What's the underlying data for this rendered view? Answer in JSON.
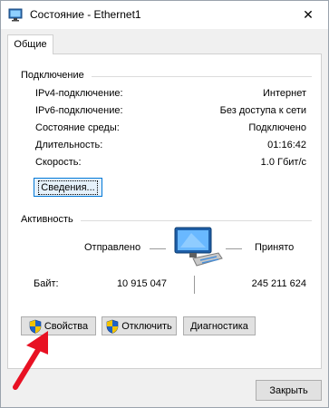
{
  "window": {
    "title": "Состояние - Ethernet1",
    "close_glyph": "✕"
  },
  "tabs": [
    {
      "label": "Общие"
    }
  ],
  "connection": {
    "header": "Подключение",
    "rows": [
      {
        "label": "IPv4-подключение:",
        "value": "Интернет"
      },
      {
        "label": "IPv6-подключение:",
        "value": "Без доступа к сети"
      },
      {
        "label": "Состояние среды:",
        "value": "Подключено"
      },
      {
        "label": "Длительность:",
        "value": "01:16:42"
      },
      {
        "label": "Скорость:",
        "value": "1.0 Гбит/с"
      }
    ],
    "details_button": "Сведения..."
  },
  "activity": {
    "header": "Активность",
    "sent_label": "Отправлено",
    "received_label": "Принято",
    "bytes_label": "Байт:",
    "bytes_sent": "10 915 047",
    "bytes_received": "245 211 624"
  },
  "actions": {
    "properties": "Свойства",
    "disable": "Отключить",
    "diagnose": "Диагностика"
  },
  "footer": {
    "close_button": "Закрыть"
  },
  "colors": {
    "accent": "#0078d7",
    "annotation_arrow": "#e81123"
  },
  "icons": [
    "network-adapter-icon",
    "close-icon",
    "network-activity-icon",
    "uac-shield-icon",
    "red-arrow-annotation"
  ]
}
